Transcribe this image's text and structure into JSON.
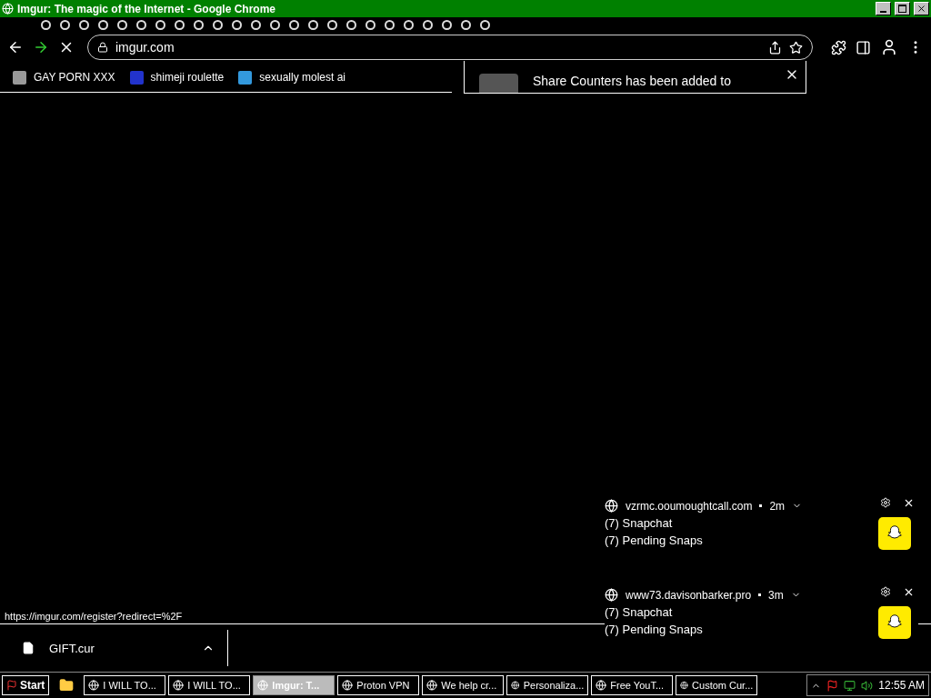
{
  "window": {
    "title": "Imgur: The magic of the Internet - Google Chrome"
  },
  "toolbar": {
    "url": "imgur.com"
  },
  "bookmarks": [
    {
      "label": "GAY PORN XXX"
    },
    {
      "label": "shimeji roulette"
    },
    {
      "label": "sexually molest ai"
    }
  ],
  "extension_popup": {
    "message": "Share Counters has been added to"
  },
  "notifications": [
    {
      "site": "vzrmc.ooumoughtcall.com",
      "age": "2m",
      "title": "(7) Snapchat",
      "body": "(7) Pending Snaps"
    },
    {
      "site": "www73.davisonbarker.pro",
      "age": "3m",
      "title": "(7) Snapchat",
      "body": "(7) Pending Snaps"
    }
  ],
  "status_bar": {
    "link": "https://imgur.com/register?redirect=%2F"
  },
  "downloads": [
    {
      "file": "GIFT.cur"
    }
  ],
  "taskbar": {
    "start": "Start",
    "items": [
      {
        "label": "I WILL TO...",
        "selected": false
      },
      {
        "label": "I WILL TO...",
        "selected": false
      },
      {
        "label": "Imgur: T...",
        "selected": true
      },
      {
        "label": "Proton VPN",
        "selected": false
      },
      {
        "label": "We help cr...",
        "selected": false
      },
      {
        "label": "Personaliza...",
        "selected": false
      },
      {
        "label": "Free YouT...",
        "selected": false
      },
      {
        "label": "Custom Cur...",
        "selected": false
      }
    ],
    "clock": "12:55 AM"
  }
}
